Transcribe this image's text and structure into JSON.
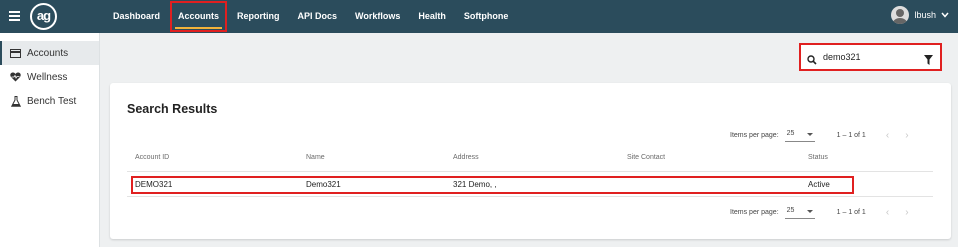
{
  "header": {
    "logo_text": "ag",
    "nav": [
      {
        "label": "Dashboard"
      },
      {
        "label": "Accounts"
      },
      {
        "label": "Reporting"
      },
      {
        "label": "API Docs"
      },
      {
        "label": "Workflows"
      },
      {
        "label": "Health"
      },
      {
        "label": "Softphone"
      }
    ],
    "active_nav": "Accounts",
    "user_name": "lbush"
  },
  "sidebar": {
    "items": [
      {
        "label": "Accounts",
        "icon": "card-icon"
      },
      {
        "label": "Wellness",
        "icon": "heart-pulse-icon"
      },
      {
        "label": "Bench Test",
        "icon": "flask-icon"
      }
    ],
    "active": "Accounts"
  },
  "search": {
    "value": "demo321"
  },
  "results": {
    "title": "Search Results",
    "pager": {
      "items_per_page_label": "Items per page:",
      "page_size": "25",
      "range": "1 – 1 of 1"
    },
    "columns": [
      "Account ID",
      "Name",
      "Address",
      "Site Contact",
      "Status"
    ],
    "rows": [
      {
        "account_id": "DEMO321",
        "name": "Demo321",
        "address": "321 Demo, ,",
        "site_contact": "",
        "status": "Active"
      }
    ]
  },
  "colors": {
    "topbar": "#2b4c5c",
    "active_underline": "#f2b33a",
    "highlight": "#e02020"
  }
}
